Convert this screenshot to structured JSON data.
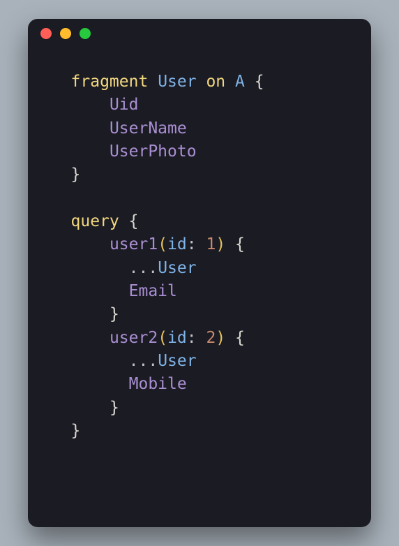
{
  "traffic_lights": {
    "red": "#ff5f56",
    "yellow": "#ffbd2e",
    "green": "#27c93f"
  },
  "code": {
    "base_indent": "   ",
    "kw_fragment": "fragment",
    "frag_name": "User",
    "kw_on": "on",
    "type_name": "A",
    "lbrace": "{",
    "rbrace": "}",
    "fields_fragment": {
      "f1": "Uid",
      "f2": "UserName",
      "f3": "UserPhoto"
    },
    "kw_query": "query",
    "user1": {
      "name": "user1",
      "arg_k": "id",
      "arg_v": "1",
      "spread": "...",
      "spread_name": "User",
      "extra": "Email"
    },
    "user2": {
      "name": "user2",
      "arg_k": "id",
      "arg_v": "2",
      "spread": "...",
      "spread_name": "User",
      "extra": "Mobile"
    },
    "lparen": "(",
    "rparen": ")",
    "colon": ":"
  }
}
